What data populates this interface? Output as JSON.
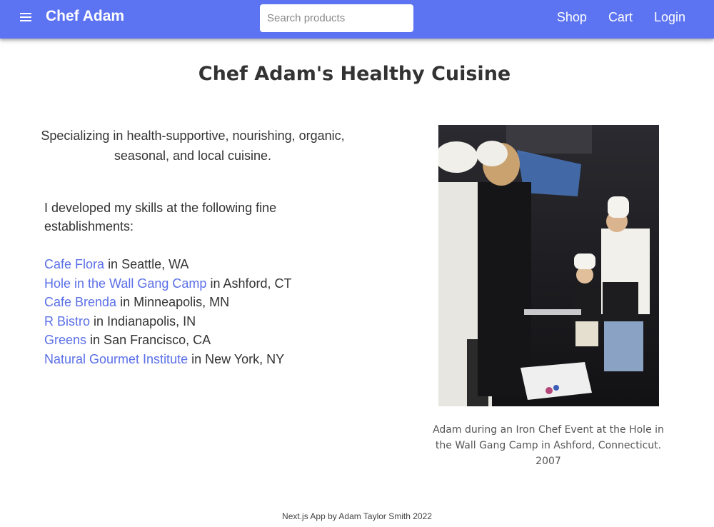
{
  "header": {
    "brand": "Chef Adam",
    "search_placeholder": "Search products",
    "nav": [
      "Shop",
      "Cart",
      "Login"
    ]
  },
  "main": {
    "title": "Chef Adam's Healthy Cuisine",
    "tagline": "Specializing in health-supportive, nourishing, organic, seasonal, and local cuisine.",
    "intro": "I developed my skills at the following fine establishments:",
    "establishments": [
      {
        "name": "Cafe Flora",
        "location": "in Seattle, WA"
      },
      {
        "name": "Hole in the Wall Gang Camp",
        "location": "in Ashford, CT"
      },
      {
        "name": "Cafe Brenda",
        "location": "in Minneapolis, MN"
      },
      {
        "name": "R Bistro",
        "location": "in Indianapolis, IN"
      },
      {
        "name": "Greens",
        "location": "in San Francisco, CA"
      },
      {
        "name": "Natural Gourmet Institute",
        "location": "in New York, NY"
      }
    ],
    "photo_caption": "Adam during an Iron Chef Event at the Hole in the Wall Gang Camp in Ashford, Connecticut. 2007"
  },
  "footer": {
    "text": "Next.js App by Adam Taylor Smith 2022"
  },
  "colors": {
    "appbar": "#5c73f2",
    "search_button": "#1a1fe6",
    "link": "#5a6fe8"
  }
}
